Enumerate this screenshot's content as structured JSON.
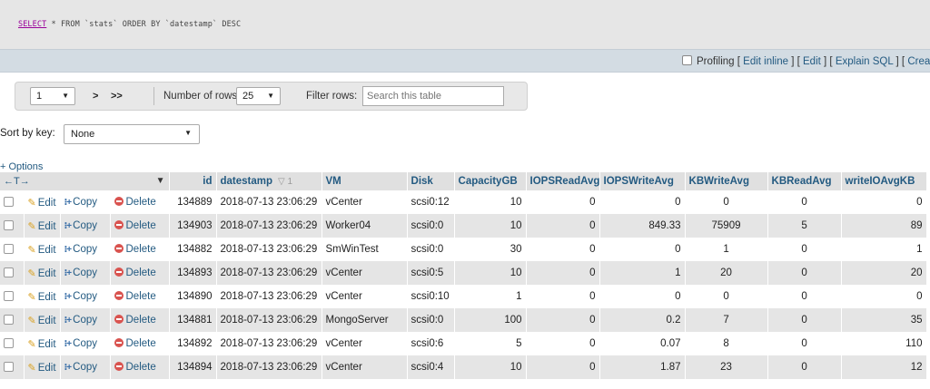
{
  "sql": {
    "keyword": "SELECT",
    "rest": " * FROM `stats` ORDER BY `datestamp` DESC"
  },
  "linkbar": {
    "profiling": "Profiling",
    "edit_inline": "Edit inline",
    "edit": "Edit",
    "explain": "Explain SQL",
    "create": "Crea"
  },
  "nav": {
    "page": "1",
    "next": ">",
    "last": ">>",
    "rows_label": "Number of rows:",
    "rows_value": "25",
    "filter_label": "Filter rows:",
    "filter_placeholder": "Search this table"
  },
  "sort": {
    "label": "Sort by key:",
    "value": "None"
  },
  "options_label": "+ Options",
  "header_arrows": "←T→",
  "sort_indicator": "▽ 1",
  "columns": [
    "id",
    "datestamp",
    "VM",
    "Disk",
    "CapacityGB",
    "IOPSReadAvg",
    "IOPSWriteAvg",
    "KBWriteAvg",
    "KBReadAvg",
    "writeIOAvgKB"
  ],
  "actions": {
    "edit": "Edit",
    "copy": "Copy",
    "delete": "Delete"
  },
  "rows": [
    [
      "134889",
      "2018-07-13 23:06:29",
      "vCenter",
      "scsi0:12",
      "10",
      "0",
      "0",
      "0",
      "0",
      "0"
    ],
    [
      "134903",
      "2018-07-13 23:06:29",
      "Worker04",
      "scsi0:0",
      "10",
      "0",
      "849.33",
      "75909",
      "5",
      "89"
    ],
    [
      "134882",
      "2018-07-13 23:06:29",
      "SmWinTest",
      "scsi0:0",
      "30",
      "0",
      "0",
      "1",
      "0",
      "1"
    ],
    [
      "134893",
      "2018-07-13 23:06:29",
      "vCenter",
      "scsi0:5",
      "10",
      "0",
      "1",
      "20",
      "0",
      "20"
    ],
    [
      "134890",
      "2018-07-13 23:06:29",
      "vCenter",
      "scsi0:10",
      "1",
      "0",
      "0",
      "0",
      "0",
      "0"
    ],
    [
      "134881",
      "2018-07-13 23:06:29",
      "MongoServer",
      "scsi0:0",
      "100",
      "0",
      "0.2",
      "7",
      "0",
      "35"
    ],
    [
      "134892",
      "2018-07-13 23:06:29",
      "vCenter",
      "scsi0:6",
      "5",
      "0",
      "0.07",
      "8",
      "0",
      "110"
    ],
    [
      "134894",
      "2018-07-13 23:06:29",
      "vCenter",
      "scsi0:4",
      "10",
      "0",
      "1.87",
      "23",
      "0",
      "12"
    ]
  ]
}
